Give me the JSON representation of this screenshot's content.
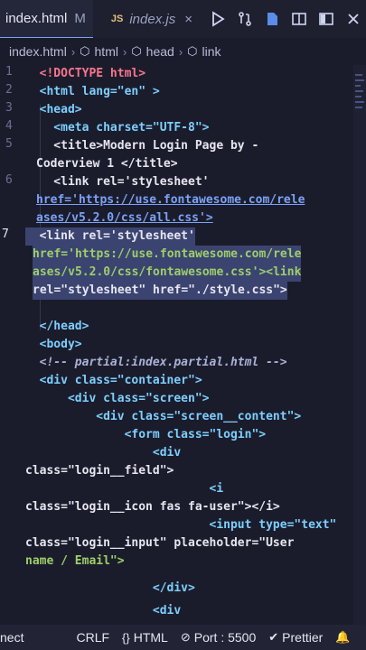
{
  "tabs": [
    {
      "label": "index.html",
      "modified": "M",
      "active": true
    },
    {
      "label": "index.js",
      "icon": "JS",
      "close": "×",
      "active": false
    }
  ],
  "toolbar": {
    "icons": [
      "run-icon",
      "git-compare-icon",
      "file-icon",
      "split-editor-icon",
      "layout-icon",
      "close-icon"
    ]
  },
  "breadcrumb": {
    "file": "index.html",
    "items": [
      "html",
      "head",
      "link"
    ]
  },
  "line_numbers": [
    "1",
    "2",
    "3",
    "4",
    "5",
    "6",
    "7"
  ],
  "code_lines": [
    "  <!DOCTYPE html>",
    "  <html lang=\"en\" >",
    "  <head>",
    "    <meta charset=\"UTF-8\">",
    "    <title>Modern Login Page by -",
    "Coderview 1 </title>",
    "    <link rel='stylesheet'",
    "href='https://use.fontawesome.com/rele",
    "ases/v5.2.0/css/all.css'>",
    "  <link rel='stylesheet'",
    "href='https://use.fontawesome.com/rele",
    "ases/v5.2.0/css/fontawesome.css'><link",
    "rel=\"stylesheet\" href=\"./style.css\">",
    "",
    "  </head>",
    "  <body>",
    "  <!-- partial:index.partial.html -->",
    "  <div class=\"container\">",
    "      <div class=\"screen\">",
    "          <div class=\"screen__content\">",
    "              <form class=\"login\">",
    "                  <div",
    "class=\"login__field\">",
    "                          <i",
    "class=\"login__icon fas fa-user\"></i>",
    "                          <input type=\"text\"",
    "class=\"login__input\" placeholder=\"User",
    "name / Email\">",
    "                  </div>",
    "                  <div"
  ],
  "status": {
    "connect": "nect",
    "eol": "CRLF",
    "language": "HTML",
    "port": "Port : 5500",
    "prettier": "Prettier"
  },
  "colors": {
    "background": "#1b1c2b",
    "tag": "#7dcfff",
    "string": "#9ece6a",
    "url": "#7aa2f7",
    "selection": "#3b4470",
    "accent": "#7aa2f7"
  }
}
